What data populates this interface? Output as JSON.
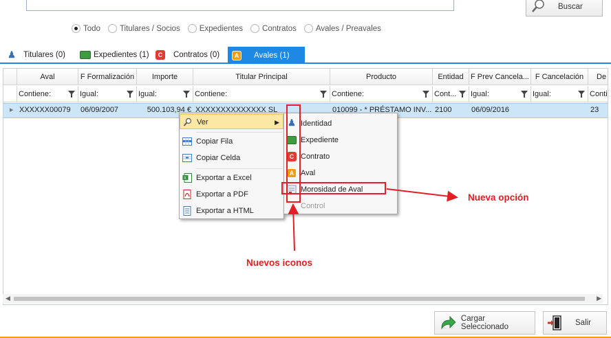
{
  "search": {
    "button_label": "Buscar"
  },
  "filters": [
    {
      "label": "Todo",
      "selected": true
    },
    {
      "label": "Titulares / Socios",
      "selected": false
    },
    {
      "label": "Expedientes",
      "selected": false
    },
    {
      "label": "Contratos",
      "selected": false
    },
    {
      "label": "Avales / Preavales",
      "selected": false
    }
  ],
  "tabs": [
    {
      "label": "Titulares (0)",
      "icon": "person-icon"
    },
    {
      "label": "Expedientes (1)",
      "icon": "folder-icon"
    },
    {
      "label": "Contratos (0)",
      "icon": "contract-c-icon"
    },
    {
      "label": "Avales (1)",
      "icon": "aval-a-icon",
      "active": true
    }
  ],
  "grid": {
    "columns": [
      "Aval",
      "F Formalización",
      "Importe",
      "Titular Principal",
      "Producto",
      "Entidad",
      "F Prev Cancela...",
      "F Cancelación",
      "De"
    ],
    "filters": [
      "Contiene:",
      "Igual:",
      "Igual:",
      "Contiene:",
      "Contiene:",
      "Cont...",
      "Igual:",
      "Igual:",
      "Conti"
    ],
    "row": [
      "XXXXXX00079",
      "06/09/2007",
      "500.103,94 €",
      "XXXXXXXXXXXXXX SL",
      "010099 - * PRÉSTAMO INV...",
      "2100",
      "06/09/2016",
      "",
      "23"
    ]
  },
  "context_menu": {
    "items": [
      "Ver",
      "Copiar Fila",
      "Copiar Celda",
      "Exportar a Excel",
      "Exportar a PDF",
      "Exportar a HTML"
    ]
  },
  "submenu": {
    "items": [
      "Identidad",
      "Expediente",
      "Contrato",
      "Aval",
      "Morosidad de Aval",
      "Control"
    ]
  },
  "annotations": {
    "new_option": "Nueva opción",
    "new_icons": "Nuevos iconos"
  },
  "footer": {
    "load_button": "Cargar Seleccionado",
    "exit_button": "Salir"
  },
  "colors": {
    "accent": "#1e88e5",
    "selected_row": "#cde6f7",
    "annotation": "#e31e24",
    "menu_highlight": "#fce7a4"
  }
}
